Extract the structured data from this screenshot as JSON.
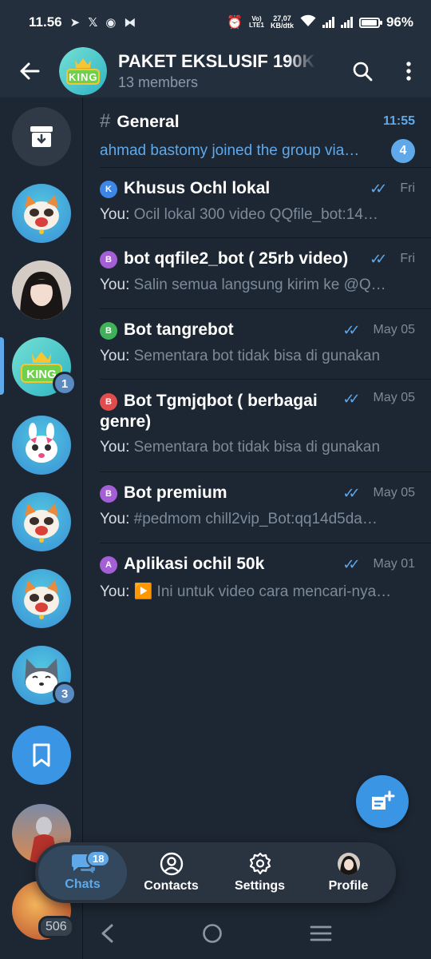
{
  "status_bar": {
    "time": "11.56",
    "net_speed_value": "27,07",
    "net_speed_unit": "KB/dtk",
    "volte_top": "Vo)",
    "volte_bottom": "LTE1",
    "battery": "96%",
    "battery_level": 0.96
  },
  "header": {
    "title": "PAKET EKSLUSIF 190K",
    "subtitle": "13 members",
    "avatar_text": "KING"
  },
  "sidebar": {
    "folders": [
      {
        "name": "archive",
        "badge": ""
      },
      {
        "name": "chat-1",
        "badge": ""
      },
      {
        "name": "chat-2",
        "badge": ""
      },
      {
        "name": "current-group",
        "badge": "1"
      },
      {
        "name": "chat-3",
        "badge": ""
      },
      {
        "name": "chat-4",
        "badge": ""
      },
      {
        "name": "chat-5",
        "badge": ""
      },
      {
        "name": "chat-6",
        "badge": "3"
      },
      {
        "name": "saved-messages",
        "badge": ""
      },
      {
        "name": "chat-7",
        "badge": ""
      },
      {
        "name": "chat-8",
        "badge": "506"
      }
    ]
  },
  "topics": [
    {
      "title": "General",
      "icon": "#",
      "time": "11:55",
      "preview": "ahmad bastomy joined the group via…",
      "unread": "4"
    },
    {
      "title": "Khusus Ochl lokal",
      "icon": "K",
      "icon_color": "#3d86e6",
      "time": "Fri",
      "sender": "You: ",
      "preview": "Ocil lokal 300 video  QQfile_bot:14…"
    },
    {
      "title": "bot qqfile2_bot ( 25rb video)",
      "icon": "B",
      "icon_color": "#a55fd6",
      "time": "Fri",
      "sender": "You: ",
      "preview": "Salin semua langsung kirim ke @Q…"
    },
    {
      "title": "Bot tangrebot",
      "icon": "B",
      "icon_color": "#3fb159",
      "time": "May 05",
      "sender": "You: ",
      "preview": "Sementara bot tidak bisa di gunakan"
    },
    {
      "title": "Bot Tgmjqbot ( berbagai genre)",
      "icon": "B",
      "icon_color": "#e14c4c",
      "time": "May 05",
      "sender": "You: ",
      "preview": "Sementara bot tidak bisa di gunakan"
    },
    {
      "title": "Bot premium",
      "icon": "B",
      "icon_color": "#a55fd6",
      "time": "May 05",
      "sender": "You: ",
      "preview": "#pedmom chill2vip_Bot:qq14d5da…"
    },
    {
      "title": "Aplikasi ochil 50k",
      "icon": "A",
      "icon_color": "#a55fd6",
      "time": "May 01",
      "sender": "You: ",
      "preview": "▶️ Ini untuk video cara mencari-nya…"
    }
  ],
  "bottom_nav": {
    "tabs": [
      {
        "label": "Chats",
        "badge": "18"
      },
      {
        "label": "Contacts"
      },
      {
        "label": "Settings"
      },
      {
        "label": "Profile"
      }
    ]
  },
  "colors": {
    "accent": "#5fa9eb",
    "background": "#1d2733",
    "header": "#242f3d"
  }
}
